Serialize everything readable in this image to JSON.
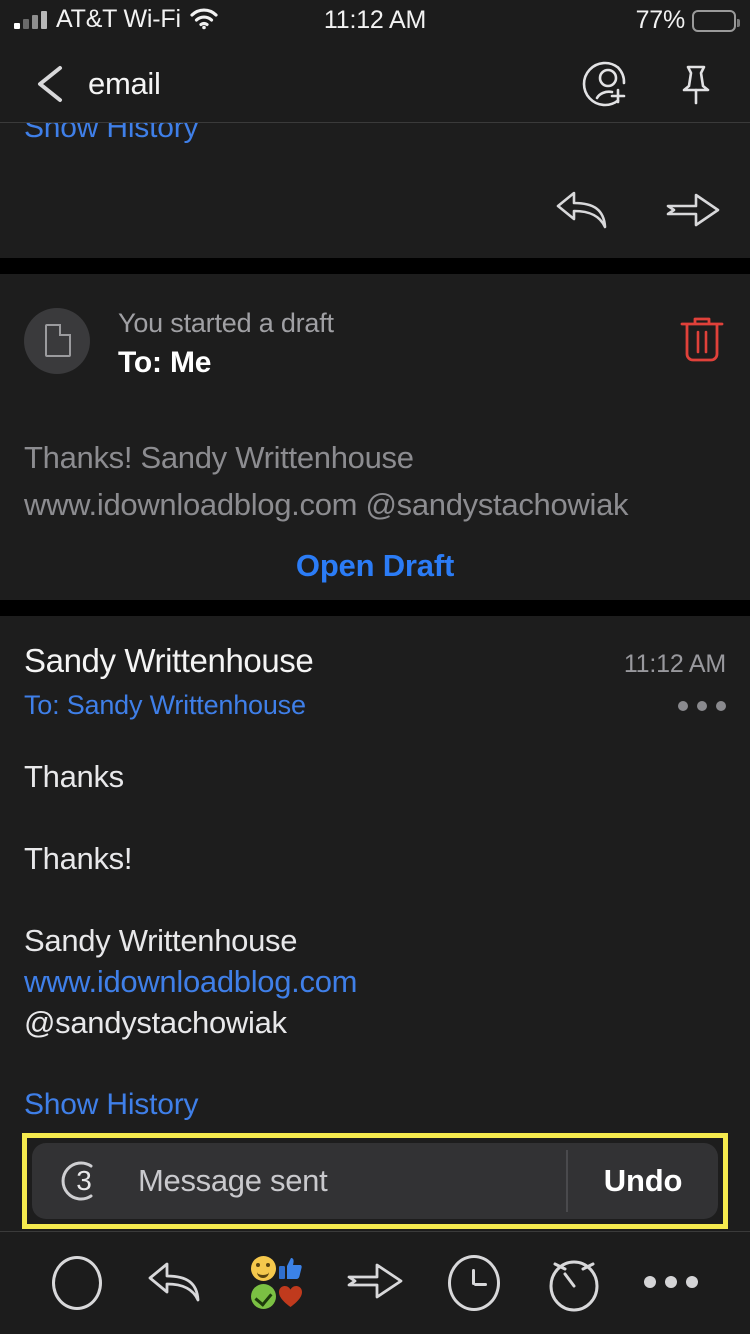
{
  "status_bar": {
    "carrier": "AT&T Wi-Fi",
    "time": "11:12 AM",
    "battery_percent": "77%",
    "signal_icon": "cellular-signal-icon",
    "wifi_icon": "wifi-icon",
    "battery_icon": "battery-icon"
  },
  "nav_bar": {
    "back_icon": "chevron-left-icon",
    "title": "email",
    "add_contact_icon": "add-person-icon",
    "pin_icon": "pin-icon"
  },
  "previous_message": {
    "show_history_label": "Show History",
    "reply_icon": "reply-arrow-icon",
    "forward_icon": "forward-arrow-icon"
  },
  "draft_card": {
    "doc_icon": "document-icon",
    "subtitle": "You started a draft",
    "recipient": "To: Me",
    "delete_icon": "trash-icon",
    "preview_line1": "Thanks! Sandy Writtenhouse",
    "preview_line2": "www.idownloadblog.com @sandystachowiak",
    "open_draft_label": "Open Draft"
  },
  "message": {
    "sender": "Sandy Writtenhouse",
    "time": "11:12 AM",
    "recipient": "To: Sandy Writtenhouse",
    "more_icon": "more-dots-icon",
    "body_line1": "Thanks",
    "body_line2": "Thanks!",
    "signature_name": "Sandy Writtenhouse",
    "signature_link": "www.idownloadblog.com",
    "signature_handle": "@sandystachowiak",
    "show_history_label": "Show History"
  },
  "toast": {
    "countdown": "3",
    "countdown_icon": "countdown-ring-icon",
    "message": "Message sent",
    "undo_label": "Undo",
    "highlight_color": "#f5ea4e"
  },
  "toolbar": {
    "items": [
      {
        "name": "mark-unread-button",
        "icon": "circle-icon"
      },
      {
        "name": "reply-button",
        "icon": "reply-arrow-icon"
      },
      {
        "name": "reactions-button",
        "icon": "emoji-reactions-icon"
      },
      {
        "name": "forward-button",
        "icon": "forward-arrow-icon"
      },
      {
        "name": "snooze-button",
        "icon": "clock-icon"
      },
      {
        "name": "remind-me-button",
        "icon": "alarm-clock-icon"
      },
      {
        "name": "more-button",
        "icon": "more-dots-icon"
      }
    ]
  },
  "colors": {
    "background": "#1c1c1c",
    "card": "#1d1d1d",
    "separator": "#000000",
    "link_blue": "#3f7fe8",
    "action_blue": "#2b7cf6",
    "delete_red": "#e0413a",
    "toast_bg": "#323234",
    "highlight_yellow": "#f5ea4e"
  }
}
